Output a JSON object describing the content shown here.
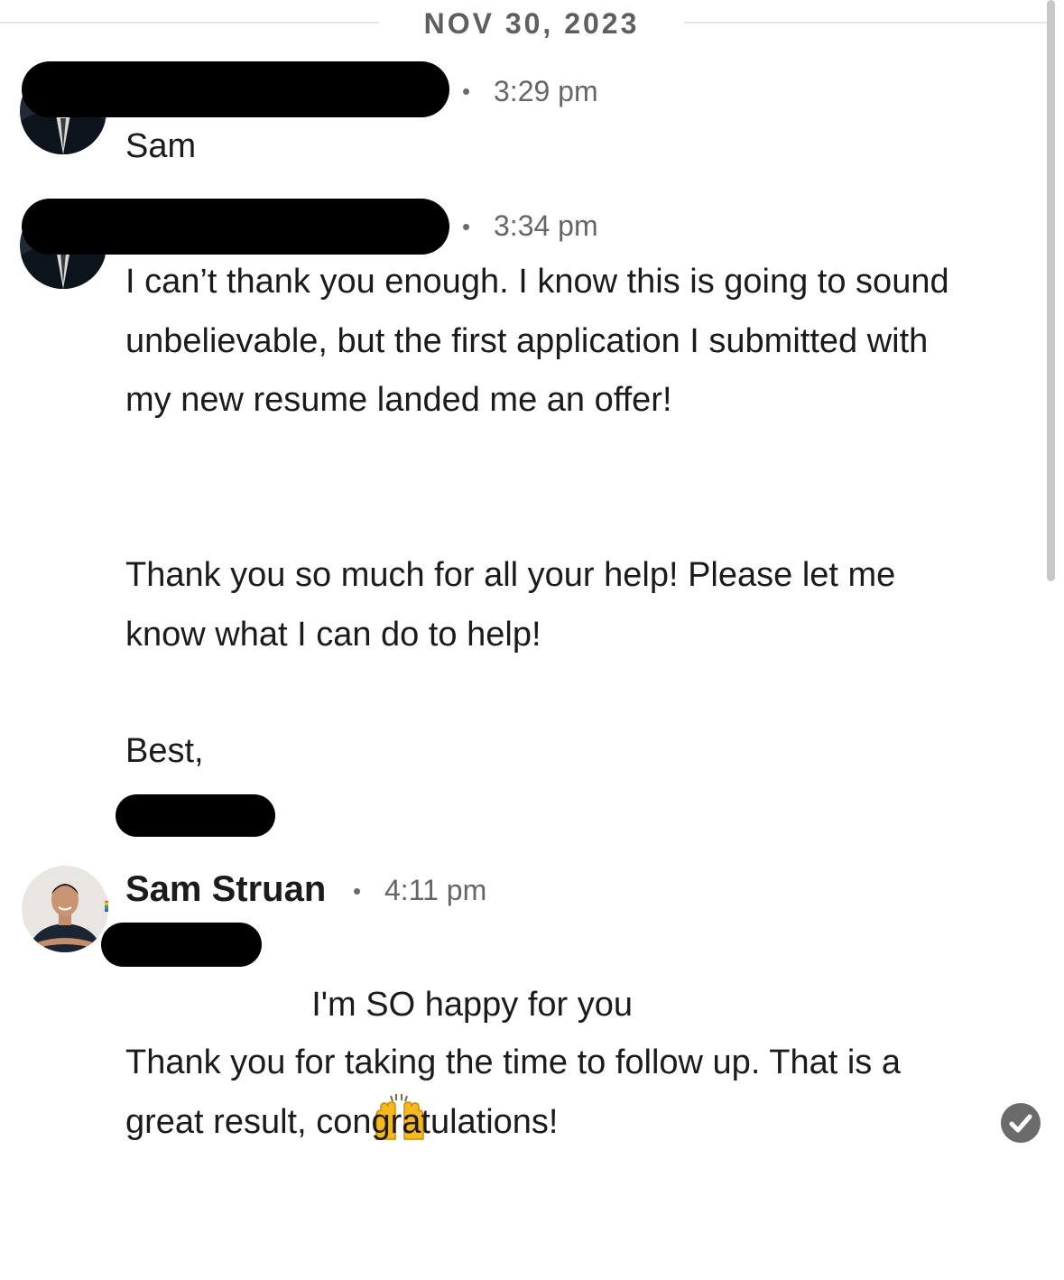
{
  "conversation": {
    "date_divider": "NOV 30, 2023",
    "messages": [
      {
        "sender_redacted": true,
        "time": "3:29 pm",
        "text": "Sam"
      },
      {
        "sender_redacted": true,
        "time": "3:34 pm",
        "text": "I can’t thank you enough. I know this is going to sound unbelievable, but the first application I submitted with my new resume landed me an offer!",
        "text_2": "Thank you so much for all your help! Please let me know what I can do to help!",
        "text_3": "Best,",
        "signature_redacted": true
      },
      {
        "sender": "Sam Struan",
        "time": "4:11 pm",
        "text": "I'm SO happy for you",
        "emoji": "🙌",
        "text_2": "Thank you for taking the time to follow up. That is a great result, congratulations!"
      }
    ],
    "separator_dot": "•",
    "read_receipt_icon": "check-circle-icon"
  },
  "colors": {
    "text": "#1b1b1b",
    "muted": "#666666",
    "redaction": "#000000"
  }
}
